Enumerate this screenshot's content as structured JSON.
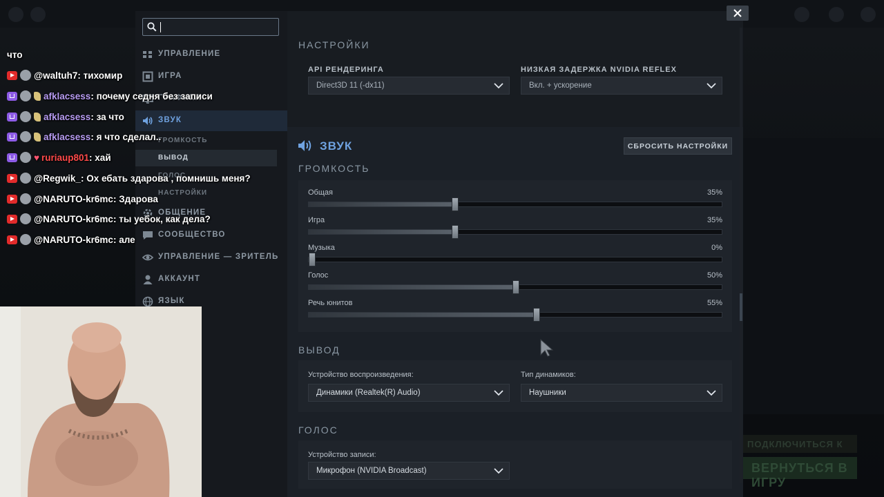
{
  "search": {
    "value": "",
    "placeholder": ""
  },
  "sidebar": {
    "items": [
      {
        "label": "УПРАВЛЕНИЕ",
        "icon": "controls-icon"
      },
      {
        "label": "ИГРА",
        "icon": "game-icon"
      },
      {
        "label": "ГРАФИКА",
        "icon": "graphics-icon"
      },
      {
        "label": "ЗВУК",
        "icon": "speaker-icon",
        "active": true
      },
      {
        "label": "ОБЩЕНИЕ",
        "icon": "gear-icon"
      },
      {
        "label": "СООБЩЕСТВО",
        "icon": "chat-icon"
      },
      {
        "label": "УПРАВЛЕНИЕ — ЗРИТЕЛЬ",
        "icon": "eye-icon"
      },
      {
        "label": "АККАУНТ",
        "icon": "user-icon"
      },
      {
        "label": "ЯЗЫК",
        "icon": "globe-icon"
      }
    ],
    "subitems": [
      {
        "label": "ГРОМКОСТЬ"
      },
      {
        "label": "ВЫВОД",
        "active": true
      },
      {
        "label": "ГОЛОС"
      },
      {
        "label": "НАСТРОЙКИ"
      }
    ]
  },
  "main": {
    "settings_heading": "НАСТРОЙКИ",
    "render_api": {
      "label": "API РЕНДЕРИНГА",
      "value": "Direct3D 11 (-dx11)"
    },
    "nvidia_reflex": {
      "label": "НИЗКАЯ ЗАДЕРЖКА NVIDIA REFLEX",
      "value": "Вкл. + ускорение"
    },
    "sound_title": "ЗВУК",
    "reset_button": "СБРОСИТЬ НАСТРОЙКИ",
    "volume_heading": "ГРОМКОСТЬ",
    "sliders": [
      {
        "label": "Общая",
        "value": 35,
        "display": "35%"
      },
      {
        "label": "Игра",
        "value": 35,
        "display": "35%"
      },
      {
        "label": "Музыка",
        "value": 0,
        "display": "0%"
      },
      {
        "label": "Голос",
        "value": 50,
        "display": "50%"
      },
      {
        "label": "Речь юнитов",
        "value": 55,
        "display": "55%"
      }
    ],
    "output_heading": "ВЫВОД",
    "playback_device": {
      "label": "Устройство воспроизведения:",
      "value": "Динамики (Realtek(R) Audio)"
    },
    "speaker_type": {
      "label": "Тип динамиков:",
      "value": "Наушники"
    },
    "voice_heading": "ГОЛОС",
    "recording_device": {
      "label": "Устройство записи:",
      "value": "Микрофон (NVIDIA Broadcast)"
    }
  },
  "background": {
    "btn1": "ПОДКЛЮЧИТЬСЯ К",
    "btn2": "ВЕРНУТЬСЯ В ИГРУ"
  },
  "chat": [
    {
      "platform": "none",
      "name": "",
      "text": "что"
    },
    {
      "platform": "youtube",
      "name": "@waltuh7",
      "text": "тихомир"
    },
    {
      "platform": "twitch",
      "name": "afklacsess",
      "text": "почему седня без записи"
    },
    {
      "platform": "twitch",
      "name": "afklacsess",
      "text": "за что"
    },
    {
      "platform": "twitch",
      "name": "afklacsess",
      "text": "я что сделал.."
    },
    {
      "platform": "twitch",
      "name": "ruriaup801",
      "text": "хай"
    },
    {
      "platform": "youtube",
      "name": "@Regwik_",
      "text": "Ох ебать здарова , помнишь меня?"
    },
    {
      "platform": "youtube",
      "name": "@NARUTO-kr6mc",
      "text": "Здарова"
    },
    {
      "platform": "youtube",
      "name": "@NARUTO-kr6mc",
      "text": "ты уебок, как дела?"
    },
    {
      "platform": "youtube",
      "name": "@NARUTO-kr6mc",
      "text": "але"
    }
  ],
  "colors": {
    "accent": "#6fa2e0",
    "panel": "#181c21",
    "sidebar": "#16191e"
  }
}
